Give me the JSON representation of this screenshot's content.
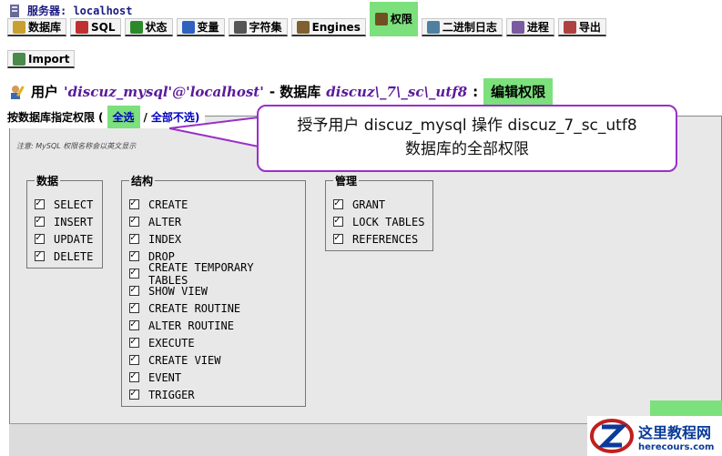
{
  "server": {
    "label": "服务器: localhost"
  },
  "tabs": [
    {
      "label": "数据库",
      "icon": "database-icon"
    },
    {
      "label": "SQL",
      "icon": "sql-icon"
    },
    {
      "label": "状态",
      "icon": "status-icon"
    },
    {
      "label": "变量",
      "icon": "variables-icon"
    },
    {
      "label": "字符集",
      "icon": "charset-icon"
    },
    {
      "label": "Engines",
      "icon": "engines-icon"
    },
    {
      "label": "权限",
      "icon": "privileges-icon",
      "active": true
    },
    {
      "label": "二进制日志",
      "icon": "binlog-icon"
    },
    {
      "label": "进程",
      "icon": "process-icon"
    },
    {
      "label": "导出",
      "icon": "export-icon"
    }
  ],
  "tabs_row2": [
    {
      "label": "Import",
      "icon": "import-icon"
    }
  ],
  "heading": {
    "user_label": "用户",
    "user_value": "'discuz_mysql'@'localhost'",
    "dash_db": "- 数据库",
    "db_value": "discuz\\_7\\_sc\\_utf8",
    "colon": ":",
    "edit_label": "编辑权限"
  },
  "panel": {
    "legend": "按数据库指定权限",
    "select_all": "全选",
    "slash": "/",
    "deselect_all": "全部不选)",
    "open_paren": "(",
    "note": "注意: MySQL 权限名称会以英文显示"
  },
  "groups": {
    "data": {
      "title": "数据",
      "items": [
        "SELECT",
        "INSERT",
        "UPDATE",
        "DELETE"
      ]
    },
    "structure": {
      "title": "结构",
      "items": [
        "CREATE",
        "ALTER",
        "INDEX",
        "DROP",
        "CREATE TEMPORARY TABLES",
        "SHOW VIEW",
        "CREATE ROUTINE",
        "ALTER ROUTINE",
        "EXECUTE",
        "CREATE VIEW",
        "EVENT",
        "TRIGGER"
      ]
    },
    "admin": {
      "title": "管理",
      "items": [
        "GRANT",
        "LOCK TABLES",
        "REFERENCES"
      ]
    }
  },
  "callout": {
    "line1": "授予用户  discuz_mysql 操作  discuz_7_sc_utf8",
    "line2": "数据库的全部权限"
  },
  "logo": {
    "title": "这里教程网",
    "url": "herecours.com"
  },
  "colors": {
    "highlight": "#7ce07c",
    "callout_border": "#9a2fc8",
    "link": "#0000c0"
  }
}
